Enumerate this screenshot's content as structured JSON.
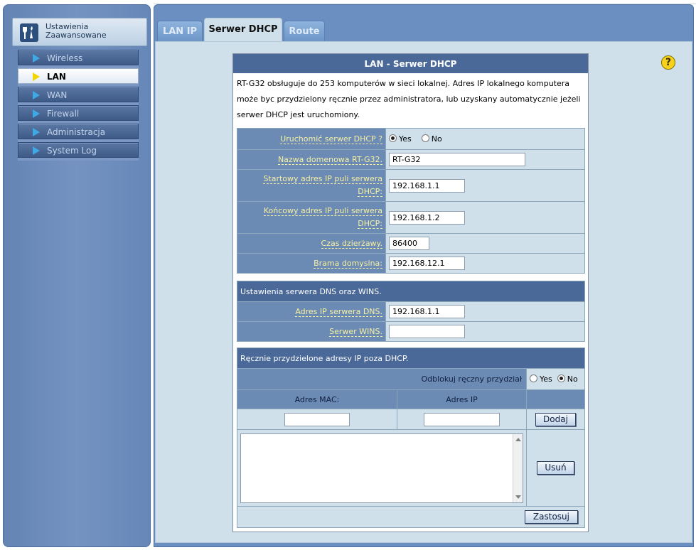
{
  "sidebar": {
    "title_line1": "Ustawienia",
    "title_line2": "Zaawansowane",
    "items": [
      {
        "label": "Wireless"
      },
      {
        "label": "LAN"
      },
      {
        "label": "WAN"
      },
      {
        "label": "Firewall"
      },
      {
        "label": "Administracja"
      },
      {
        "label": "System Log"
      }
    ],
    "active_index": 1
  },
  "tabs": [
    {
      "label": "LAN IP"
    },
    {
      "label": "Serwer DHCP"
    },
    {
      "label": "Route"
    }
  ],
  "help": {
    "label": "?"
  },
  "panel": {
    "title": "LAN - Serwer DHCP",
    "description": "RT-G32 obsługuje do 253 komputerów w sieci lokalnej. Adres IP lokalnego komputera może byc przydzielony ręcznie przez administratora, lub uzyskany automatycznie jeżeli serwer DHCP jest uruchomiony."
  },
  "dhcp": {
    "enable_label": "Uruchomić serwer DHCP ?",
    "yes": "Yes",
    "no": "No",
    "enable_value": "Yes",
    "domain_label": "Nazwa domenowa RT-G32.",
    "domain_value": "RT-G32",
    "start_label": "Startowy adres IP puli serwera DHCP:",
    "start_value": "192.168.1.1",
    "end_label": "Końcowy adres IP puli serwera DHCP:",
    "end_value": "192.168.1.2",
    "lease_label": "Czas dzierżawy.",
    "lease_value": "86400",
    "gateway_label": "Brama domyslna:",
    "gateway_value": "192.168.12.1"
  },
  "dns": {
    "section_title": "Ustawienia serwera DNS oraz WINS.",
    "dns_label": "Adres IP serwera DNS.",
    "dns_value": "192.168.1.1",
    "wins_label": "Serwer WINS.",
    "wins_value": ""
  },
  "manual": {
    "section_title": "Ręcznie przydzielone adresy IP poza DHCP.",
    "unlock_label": "Odblokuj ręczny przydział",
    "yes": "Yes",
    "no": "No",
    "unlock_value": "No",
    "mac_header": "Adres MAC:",
    "ip_header": "Adres IP",
    "mac_value": "",
    "ip_value": "",
    "add_button": "Dodaj",
    "remove_button": "Usuń",
    "apply_button": "Zastosuj"
  }
}
